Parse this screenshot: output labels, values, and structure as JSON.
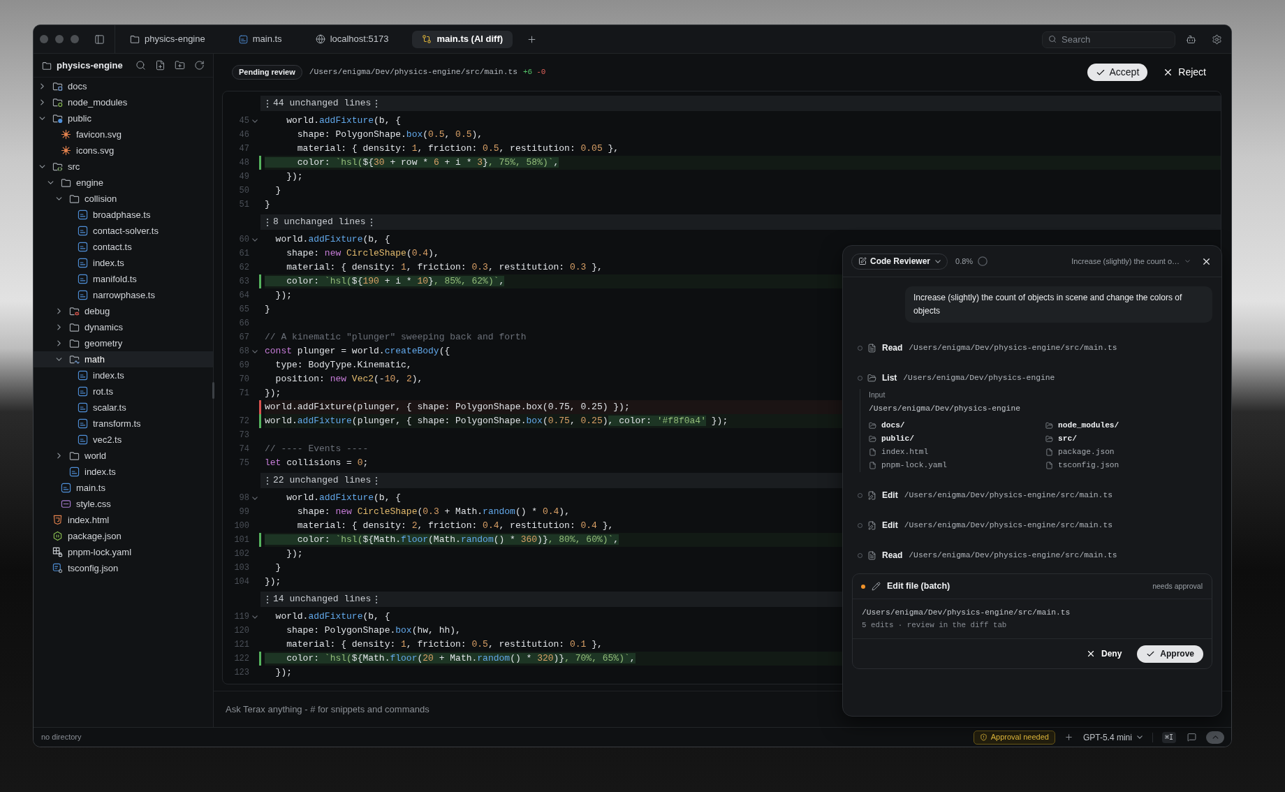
{
  "tabs": [
    {
      "label": "physics-engine",
      "kind": "folder",
      "selected": false
    },
    {
      "label": "main.ts",
      "kind": "ts",
      "selected": false
    },
    {
      "label": "localhost:5173",
      "kind": "web",
      "selected": false
    },
    {
      "label": "main.ts (AI diff)",
      "kind": "diff",
      "selected": true
    }
  ],
  "search": {
    "placeholder": "Search"
  },
  "sidebar": {
    "title": "physics-engine",
    "tree": [
      {
        "name": "docs",
        "kind": "docs",
        "expanded": false,
        "selected": false
      },
      {
        "name": "node_modules",
        "kind": "modules",
        "expanded": false,
        "selected": false
      },
      {
        "name": "public",
        "kind": "web",
        "expanded": true,
        "selected": false,
        "children": [
          {
            "name": "favicon.svg",
            "kind": "svg",
            "selected": false
          },
          {
            "name": "icons.svg",
            "kind": "svg",
            "selected": false
          }
        ]
      },
      {
        "name": "src",
        "kind": "code",
        "expanded": true,
        "selected": false,
        "children": [
          {
            "name": "engine",
            "kind": "folder",
            "expanded": true,
            "selected": false,
            "children": [
              {
                "name": "collision",
                "kind": "folder",
                "expanded": true,
                "selected": false,
                "children": [
                  {
                    "name": "broadphase.ts",
                    "kind": "ts",
                    "selected": false
                  },
                  {
                    "name": "contact-solver.ts",
                    "kind": "ts",
                    "selected": false
                  },
                  {
                    "name": "contact.ts",
                    "kind": "ts",
                    "selected": false
                  },
                  {
                    "name": "index.ts",
                    "kind": "ts",
                    "selected": false
                  },
                  {
                    "name": "manifold.ts",
                    "kind": "ts",
                    "selected": false
                  },
                  {
                    "name": "narrowphase.ts",
                    "kind": "ts",
                    "selected": false
                  }
                ]
              },
              {
                "name": "debug",
                "kind": "bug",
                "expanded": false,
                "selected": false
              },
              {
                "name": "dynamics",
                "kind": "folder",
                "expanded": false,
                "selected": false
              },
              {
                "name": "geometry",
                "kind": "folder",
                "expanded": false,
                "selected": false
              },
              {
                "name": "math",
                "kind": "formula",
                "expanded": true,
                "selected": true,
                "children": [
                  {
                    "name": "index.ts",
                    "kind": "ts",
                    "selected": false
                  },
                  {
                    "name": "rot.ts",
                    "kind": "ts",
                    "selected": false
                  },
                  {
                    "name": "scalar.ts",
                    "kind": "ts",
                    "selected": false
                  },
                  {
                    "name": "transform.ts",
                    "kind": "ts",
                    "selected": false
                  },
                  {
                    "name": "vec2.ts",
                    "kind": "ts",
                    "selected": false
                  }
                ]
              },
              {
                "name": "world",
                "kind": "folder",
                "expanded": false,
                "selected": false
              },
              {
                "name": "index.ts",
                "kind": "ts",
                "selected": false
              }
            ]
          },
          {
            "name": "main.ts",
            "kind": "ts",
            "selected": false
          },
          {
            "name": "style.css",
            "kind": "css",
            "selected": false
          }
        ]
      },
      {
        "name": "index.html",
        "kind": "html",
        "selected": false
      },
      {
        "name": "package.json",
        "kind": "json",
        "selected": false
      },
      {
        "name": "pnpm-lock.yaml",
        "kind": "lock",
        "selected": false
      },
      {
        "name": "tsconfig.json",
        "kind": "tsconfig",
        "selected": false
      }
    ]
  },
  "review_bar": {
    "badge": "Pending review",
    "path": "/Users/enigma/Dev/physics-engine/src/main.ts",
    "added": "+6",
    "removed": "-0",
    "buttons": [
      {
        "label": "Accept",
        "kind": "accept"
      },
      {
        "label": "Reject",
        "kind": "reject"
      }
    ]
  },
  "diff": {
    "rows": [
      {
        "kind": "unchanged",
        "label": "44 unchanged lines"
      },
      {
        "kind": "context",
        "number": "45",
        "foldable": true,
        "tokens": [
          {
            "kind": "plain",
            "text": "    world."
          },
          {
            "kind": "fn",
            "text": "addFixture"
          },
          {
            "kind": "plain",
            "text": "(b, {"
          }
        ]
      },
      {
        "kind": "context",
        "number": "46",
        "foldable": false,
        "tokens": [
          {
            "kind": "plain",
            "text": "      shape: PolygonShape."
          },
          {
            "kind": "fn",
            "text": "box"
          },
          {
            "kind": "plain",
            "text": "("
          },
          {
            "kind": "num",
            "text": "0.5"
          },
          {
            "kind": "plain",
            "text": ", "
          },
          {
            "kind": "num",
            "text": "0.5"
          },
          {
            "kind": "plain",
            "text": "),"
          }
        ]
      },
      {
        "kind": "context",
        "number": "47",
        "foldable": false,
        "tokens": [
          {
            "kind": "plain",
            "text": "      material: { density: "
          },
          {
            "kind": "num",
            "text": "1"
          },
          {
            "kind": "plain",
            "text": ", friction: "
          },
          {
            "kind": "num",
            "text": "0.5"
          },
          {
            "kind": "plain",
            "text": ", restitution: "
          },
          {
            "kind": "num",
            "text": "0.05"
          },
          {
            "kind": "plain",
            "text": " },"
          }
        ]
      },
      {
        "kind": "added",
        "number": "48",
        "foldable": false,
        "segments": [
          {
            "changed": true,
            "tokens": [
              {
                "kind": "plain",
                "text": "      color: "
              },
              {
                "kind": "str",
                "text": "`hsl("
              },
              {
                "kind": "plain",
                "text": "${"
              },
              {
                "kind": "num",
                "text": "30"
              },
              {
                "kind": "plain",
                "text": " + row * "
              },
              {
                "kind": "num",
                "text": "6"
              },
              {
                "kind": "plain",
                "text": " + i * "
              },
              {
                "kind": "num",
                "text": "3"
              },
              {
                "kind": "plain",
                "text": "}"
              },
              {
                "kind": "str",
                "text": ", 75%, 58%)`"
              },
              {
                "kind": "plain",
                "text": ","
              }
            ]
          }
        ]
      },
      {
        "kind": "context",
        "number": "49",
        "foldable": false,
        "tokens": [
          {
            "kind": "plain",
            "text": "    });"
          }
        ]
      },
      {
        "kind": "context",
        "number": "50",
        "foldable": false,
        "tokens": [
          {
            "kind": "plain",
            "text": "  }"
          }
        ]
      },
      {
        "kind": "context",
        "number": "51",
        "foldable": false,
        "tokens": [
          {
            "kind": "plain",
            "text": "}"
          }
        ]
      },
      {
        "kind": "unchanged",
        "label": "8 unchanged lines"
      },
      {
        "kind": "context",
        "number": "60",
        "foldable": true,
        "tokens": [
          {
            "kind": "plain",
            "text": "  world."
          },
          {
            "kind": "fn",
            "text": "addFixture"
          },
          {
            "kind": "plain",
            "text": "(b, {"
          }
        ]
      },
      {
        "kind": "context",
        "number": "61",
        "foldable": false,
        "tokens": [
          {
            "kind": "plain",
            "text": "    shape: "
          },
          {
            "kind": "kw",
            "text": "new "
          },
          {
            "kind": "cls",
            "text": "CircleShape"
          },
          {
            "kind": "plain",
            "text": "("
          },
          {
            "kind": "num",
            "text": "0.4"
          },
          {
            "kind": "plain",
            "text": "),"
          }
        ]
      },
      {
        "kind": "context",
        "number": "62",
        "foldable": false,
        "tokens": [
          {
            "kind": "plain",
            "text": "    material: { density: "
          },
          {
            "kind": "num",
            "text": "1"
          },
          {
            "kind": "plain",
            "text": ", friction: "
          },
          {
            "kind": "num",
            "text": "0.3"
          },
          {
            "kind": "plain",
            "text": ", restitution: "
          },
          {
            "kind": "num",
            "text": "0.3"
          },
          {
            "kind": "plain",
            "text": " },"
          }
        ]
      },
      {
        "kind": "added",
        "number": "63",
        "foldable": false,
        "segments": [
          {
            "changed": true,
            "tokens": [
              {
                "kind": "plain",
                "text": "    color: "
              },
              {
                "kind": "str",
                "text": "`hsl("
              },
              {
                "kind": "plain",
                "text": "${"
              },
              {
                "kind": "num",
                "text": "190"
              },
              {
                "kind": "plain",
                "text": " + i * "
              },
              {
                "kind": "num",
                "text": "10"
              },
              {
                "kind": "plain",
                "text": "}"
              },
              {
                "kind": "str",
                "text": ", 85%, 62%)`"
              },
              {
                "kind": "plain",
                "text": ","
              }
            ]
          }
        ]
      },
      {
        "kind": "context",
        "number": "64",
        "foldable": false,
        "tokens": [
          {
            "kind": "plain",
            "text": "  });"
          }
        ]
      },
      {
        "kind": "context",
        "number": "65",
        "foldable": false,
        "tokens": [
          {
            "kind": "plain",
            "text": "}"
          }
        ]
      },
      {
        "kind": "context",
        "number": "66",
        "foldable": false
      },
      {
        "kind": "context",
        "number": "67",
        "foldable": false,
        "tokens": [
          {
            "kind": "com",
            "text": "// A kinematic \"plunger\" sweeping back and forth"
          }
        ]
      },
      {
        "kind": "context",
        "number": "68",
        "foldable": true,
        "tokens": [
          {
            "kind": "kw",
            "text": "const"
          },
          {
            "kind": "plain",
            "text": " plunger = world."
          },
          {
            "kind": "fn",
            "text": "createBody"
          },
          {
            "kind": "plain",
            "text": "({"
          }
        ]
      },
      {
        "kind": "context",
        "number": "69",
        "foldable": false,
        "tokens": [
          {
            "kind": "plain",
            "text": "  type: BodyType.Kinematic,"
          }
        ]
      },
      {
        "kind": "context",
        "number": "70",
        "foldable": false,
        "tokens": [
          {
            "kind": "plain",
            "text": "  position: "
          },
          {
            "kind": "kw",
            "text": "new "
          },
          {
            "kind": "cls",
            "text": "Vec2"
          },
          {
            "kind": "plain",
            "text": "(-"
          },
          {
            "kind": "num",
            "text": "10"
          },
          {
            "kind": "plain",
            "text": ", "
          },
          {
            "kind": "num",
            "text": "2"
          },
          {
            "kind": "plain",
            "text": "),"
          }
        ]
      },
      {
        "kind": "context",
        "number": "71",
        "foldable": false,
        "tokens": [
          {
            "kind": "plain",
            "text": "});"
          }
        ]
      },
      {
        "kind": "removed",
        "foldable": false,
        "tokens": [
          {
            "kind": "plain",
            "text": "world.addFixture(plunger, { shape: PolygonShape.box(0.75, 0.25) });"
          }
        ]
      },
      {
        "kind": "added",
        "number": "72",
        "foldable": false,
        "segments": [
          {
            "changed": false,
            "tokens": [
              {
                "kind": "plain",
                "text": "world."
              },
              {
                "kind": "fn",
                "text": "addFixture"
              },
              {
                "kind": "plain",
                "text": "(plunger, { shape: PolygonShape."
              },
              {
                "kind": "fn",
                "text": "box"
              },
              {
                "kind": "plain",
                "text": "("
              },
              {
                "kind": "num",
                "text": "0.75"
              },
              {
                "kind": "plain",
                "text": ", "
              },
              {
                "kind": "num",
                "text": "0.25"
              },
              {
                "kind": "plain",
                "text": ")"
              }
            ]
          },
          {
            "changed": true,
            "tokens": [
              {
                "kind": "plain",
                "text": ", color: "
              },
              {
                "kind": "str",
                "text": "'#f8f0a4'"
              }
            ]
          },
          {
            "changed": false,
            "tokens": [
              {
                "kind": "plain",
                "text": " });"
              }
            ]
          }
        ]
      },
      {
        "kind": "context",
        "number": "73",
        "foldable": false
      },
      {
        "kind": "context",
        "number": "74",
        "foldable": false,
        "tokens": [
          {
            "kind": "com",
            "text": "// ---- Events ----"
          }
        ]
      },
      {
        "kind": "context",
        "number": "75",
        "foldable": false,
        "tokens": [
          {
            "kind": "kw",
            "text": "let"
          },
          {
            "kind": "plain",
            "text": " collisions = "
          },
          {
            "kind": "num",
            "text": "0"
          },
          {
            "kind": "plain",
            "text": ";"
          }
        ]
      },
      {
        "kind": "unchanged",
        "label": "22 unchanged lines"
      },
      {
        "kind": "context",
        "number": "98",
        "foldable": true,
        "tokens": [
          {
            "kind": "plain",
            "text": "    world."
          },
          {
            "kind": "fn",
            "text": "addFixture"
          },
          {
            "kind": "plain",
            "text": "(b, {"
          }
        ]
      },
      {
        "kind": "context",
        "number": "99",
        "foldable": false,
        "tokens": [
          {
            "kind": "plain",
            "text": "      shape: "
          },
          {
            "kind": "kw",
            "text": "new "
          },
          {
            "kind": "cls",
            "text": "CircleShape"
          },
          {
            "kind": "plain",
            "text": "("
          },
          {
            "kind": "num",
            "text": "0.3"
          },
          {
            "kind": "plain",
            "text": " + Math."
          },
          {
            "kind": "fn",
            "text": "random"
          },
          {
            "kind": "plain",
            "text": "() * "
          },
          {
            "kind": "num",
            "text": "0.4"
          },
          {
            "kind": "plain",
            "text": "),"
          }
        ]
      },
      {
        "kind": "context",
        "number": "100",
        "foldable": false,
        "tokens": [
          {
            "kind": "plain",
            "text": "      material: { density: "
          },
          {
            "kind": "num",
            "text": "2"
          },
          {
            "kind": "plain",
            "text": ", friction: "
          },
          {
            "kind": "num",
            "text": "0.4"
          },
          {
            "kind": "plain",
            "text": ", restitution: "
          },
          {
            "kind": "num",
            "text": "0.4"
          },
          {
            "kind": "plain",
            "text": " },"
          }
        ]
      },
      {
        "kind": "added",
        "number": "101",
        "foldable": false,
        "segments": [
          {
            "changed": true,
            "tokens": [
              {
                "kind": "plain",
                "text": "      color: "
              },
              {
                "kind": "str",
                "text": "`hsl("
              },
              {
                "kind": "plain",
                "text": "${Math."
              },
              {
                "kind": "fn",
                "text": "floor"
              },
              {
                "kind": "plain",
                "text": "(Math."
              },
              {
                "kind": "fn",
                "text": "random"
              },
              {
                "kind": "plain",
                "text": "() * "
              },
              {
                "kind": "num",
                "text": "360"
              },
              {
                "kind": "plain",
                "text": ")}"
              },
              {
                "kind": "str",
                "text": ", 80%, 60%)`"
              },
              {
                "kind": "plain",
                "text": ","
              }
            ]
          }
        ]
      },
      {
        "kind": "context",
        "number": "102",
        "foldable": false,
        "tokens": [
          {
            "kind": "plain",
            "text": "    });"
          }
        ]
      },
      {
        "kind": "context",
        "number": "103",
        "foldable": false,
        "tokens": [
          {
            "kind": "plain",
            "text": "  }"
          }
        ]
      },
      {
        "kind": "context",
        "number": "104",
        "foldable": false,
        "tokens": [
          {
            "kind": "plain",
            "text": "});"
          }
        ]
      },
      {
        "kind": "unchanged",
        "label": "14 unchanged lines"
      },
      {
        "kind": "context",
        "number": "119",
        "foldable": true,
        "tokens": [
          {
            "kind": "plain",
            "text": "  world."
          },
          {
            "kind": "fn",
            "text": "addFixture"
          },
          {
            "kind": "plain",
            "text": "(b, {"
          }
        ]
      },
      {
        "kind": "context",
        "number": "120",
        "foldable": false,
        "tokens": [
          {
            "kind": "plain",
            "text": "    shape: PolygonShape."
          },
          {
            "kind": "fn",
            "text": "box"
          },
          {
            "kind": "plain",
            "text": "(hw, hh),"
          }
        ]
      },
      {
        "kind": "context",
        "number": "121",
        "foldable": false,
        "tokens": [
          {
            "kind": "plain",
            "text": "    material: { density: "
          },
          {
            "kind": "num",
            "text": "1"
          },
          {
            "kind": "plain",
            "text": ", friction: "
          },
          {
            "kind": "num",
            "text": "0.5"
          },
          {
            "kind": "plain",
            "text": ", restitution: "
          },
          {
            "kind": "num",
            "text": "0.1"
          },
          {
            "kind": "plain",
            "text": " },"
          }
        ]
      },
      {
        "kind": "added",
        "number": "122",
        "foldable": false,
        "segments": [
          {
            "changed": true,
            "tokens": [
              {
                "kind": "plain",
                "text": "    color: "
              },
              {
                "kind": "str",
                "text": "`hsl("
              },
              {
                "kind": "plain",
                "text": "${Math."
              },
              {
                "kind": "fn",
                "text": "floor"
              },
              {
                "kind": "plain",
                "text": "("
              },
              {
                "kind": "num",
                "text": "20"
              },
              {
                "kind": "plain",
                "text": " + Math."
              },
              {
                "kind": "fn",
                "text": "random"
              },
              {
                "kind": "plain",
                "text": "() * "
              },
              {
                "kind": "num",
                "text": "320"
              },
              {
                "kind": "plain",
                "text": ")}"
              },
              {
                "kind": "str",
                "text": ", 70%, 65%)`"
              },
              {
                "kind": "plain",
                "text": ","
              }
            ]
          }
        ]
      },
      {
        "kind": "context",
        "number": "123",
        "foldable": false,
        "tokens": [
          {
            "kind": "plain",
            "text": "  });"
          }
        ]
      }
    ]
  },
  "chat_input": {
    "placeholder": "Ask Terax anything - # for snippets and commands"
  },
  "reviewer": {
    "agent": "Code Reviewer",
    "usage": "0.8%",
    "thread": "Increase (slightly) the count o…",
    "message": "Increase (slightly) the count of objects in scene and change the colors of objects",
    "steps": [
      {
        "kind": "read",
        "label": "Read",
        "path": "/Users/enigma/Dev/physics-engine/src/main.ts"
      },
      {
        "kind": "list",
        "label": "List",
        "path": "/Users/enigma/Dev/physics-engine",
        "details": {
          "label": "Input",
          "path": "/Users/enigma/Dev/physics-engine",
          "entries": [
            {
              "name": "docs/",
              "kind": "dir"
            },
            {
              "name": "node_modules/",
              "kind": "dir"
            },
            {
              "name": "public/",
              "kind": "dir"
            },
            {
              "name": "src/",
              "kind": "dir"
            },
            {
              "name": "index.html",
              "kind": "file"
            },
            {
              "name": "package.json",
              "kind": "file"
            },
            {
              "name": "pnpm-lock.yaml",
              "kind": "file"
            },
            {
              "name": "tsconfig.json",
              "kind": "file"
            }
          ]
        }
      },
      {
        "kind": "edit",
        "label": "Edit",
        "path": "/Users/enigma/Dev/physics-engine/src/main.ts"
      },
      {
        "kind": "edit",
        "label": "Edit",
        "path": "/Users/enigma/Dev/physics-engine/src/main.ts"
      },
      {
        "kind": "read",
        "label": "Read",
        "path": "/Users/enigma/Dev/physics-engine/src/main.ts"
      }
    ],
    "approval": {
      "title": "Edit file (batch)",
      "status": "needs approval",
      "path": "/Users/enigma/Dev/physics-engine/src/main.ts",
      "summary": "5 edits · review in the diff tab",
      "buttons": [
        {
          "label": "Deny",
          "kind": "deny"
        },
        {
          "label": "Approve",
          "kind": "approve"
        }
      ]
    }
  },
  "status_bar": {
    "directory": "no directory",
    "approval": "Approval needed",
    "model": "GPT-5.4 mini",
    "shortcut": "⌘I"
  }
}
